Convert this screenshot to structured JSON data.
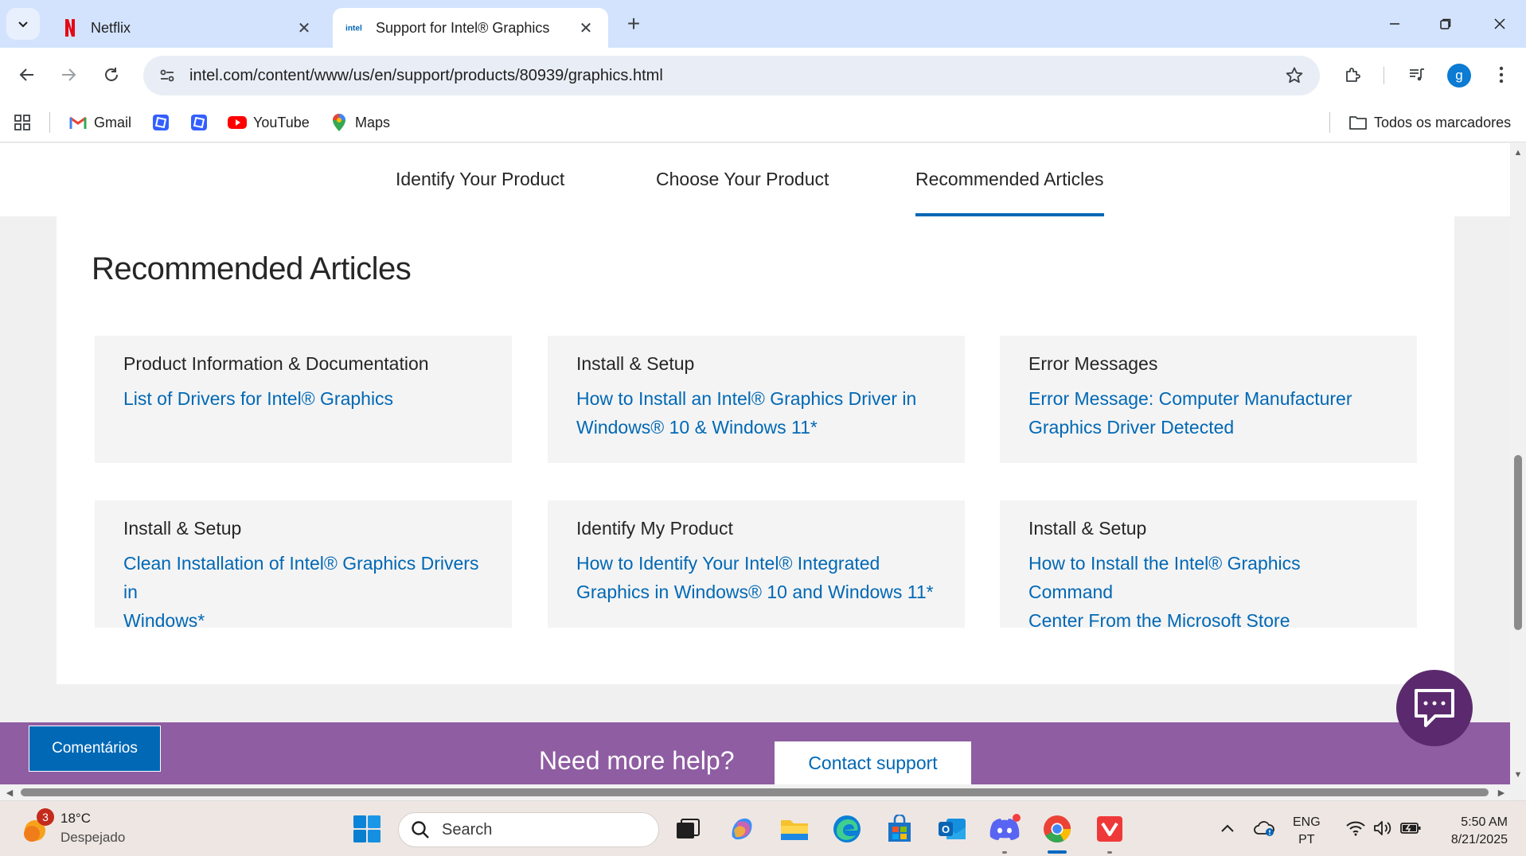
{
  "browser": {
    "tabs": [
      {
        "title": "Netflix",
        "active": false
      },
      {
        "title": "Support for Intel® Graphics",
        "active": true
      }
    ],
    "address": "intel.com/content/www/us/en/support/products/80939/graphics.html",
    "profile_initial": "g",
    "bookmarks": [
      {
        "label": "Gmail"
      },
      {
        "label": ""
      },
      {
        "label": ""
      },
      {
        "label": "YouTube"
      },
      {
        "label": "Maps"
      }
    ],
    "all_bookmarks_label": "Todos os marcadores"
  },
  "page": {
    "subnav": [
      {
        "label": "Identify Your Product",
        "active": false
      },
      {
        "label": "Choose Your Product",
        "active": false
      },
      {
        "label": "Recommended Articles",
        "active": true
      }
    ],
    "heading": "Recommended Articles",
    "cards": [
      {
        "category": "Product Information & Documentation",
        "link_lines": [
          "List of Drivers for Intel® Graphics"
        ]
      },
      {
        "category": "Install & Setup",
        "link_lines": [
          "How to Install an Intel® Graphics Driver in",
          "Windows® 10 & Windows 11*"
        ]
      },
      {
        "category": "Error Messages",
        "link_lines": [
          "Error Message: Computer Manufacturer",
          "Graphics Driver Detected"
        ]
      },
      {
        "category": "Install & Setup",
        "link_lines": [
          "Clean Installation of Intel® Graphics Drivers in",
          "Windows*"
        ]
      },
      {
        "category": "Identify My Product",
        "link_lines": [
          "How to Identify Your Intel® Integrated",
          "Graphics in Windows® 10 and Windows 11*"
        ]
      },
      {
        "category": "Install & Setup",
        "link_lines": [
          "How to Install the Intel® Graphics Command",
          "Center From the Microsoft Store"
        ]
      }
    ],
    "help": {
      "feedback_label": "Comentários",
      "title": "Need more help?",
      "contact_label": "Contact support"
    }
  },
  "taskbar": {
    "weather": {
      "temp": "18°C",
      "condition": "Despejado",
      "badge": "3"
    },
    "search_placeholder": "Search",
    "lang_top": "ENG",
    "lang_bottom": "PT",
    "time": "5:50 AM",
    "date": "8/21/2025"
  },
  "colors": {
    "intel_blue": "#0068b5",
    "help_band": "#8f5da2",
    "chat_bubble": "#5b2a6e"
  }
}
